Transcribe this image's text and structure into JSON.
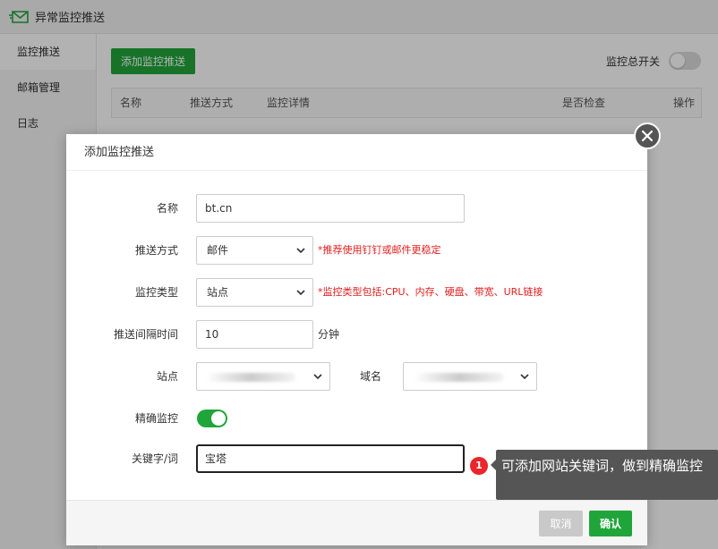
{
  "app": {
    "title": "异常监控推送"
  },
  "sidebar": {
    "items": [
      {
        "label": "监控推送"
      },
      {
        "label": "邮箱管理"
      },
      {
        "label": "日志"
      }
    ]
  },
  "content": {
    "add_button_label": "添加监控推送",
    "master_switch_label": "监控总开关",
    "table_headers": [
      "名称",
      "推送方式",
      "监控详情",
      "是否检查",
      "操作"
    ]
  },
  "modal": {
    "title": "添加监控推送",
    "fields": {
      "name": {
        "label": "名称",
        "value": "bt.cn"
      },
      "push_method": {
        "label": "推送方式",
        "value": "邮件",
        "hint": "*推荐使用钉钉或邮件更稳定"
      },
      "monitor_type": {
        "label": "监控类型",
        "value": "站点",
        "hint": "*监控类型包括:CPU、内存、硬盘、带宽、URL链接"
      },
      "interval": {
        "label": "推送间隔时间",
        "value": "10",
        "unit": "分钟"
      },
      "site": {
        "label": "站点"
      },
      "domain": {
        "label": "域名"
      },
      "precise": {
        "label": "精确监控",
        "enabled": true
      },
      "keyword": {
        "label": "关键字/词",
        "value": "宝塔"
      }
    },
    "cancel_label": "取消",
    "confirm_label": "确认"
  },
  "tooltip": {
    "step": "1",
    "text": "可添加网站关键词，做到精确监控"
  },
  "colors": {
    "accent": "#20a53a",
    "hint": "#e31d1d",
    "tooltip_bg": "#555555",
    "badge": "#e8262b"
  },
  "icons": [
    "envelope-logo-icon",
    "close-icon",
    "chevron-down-icon"
  ]
}
